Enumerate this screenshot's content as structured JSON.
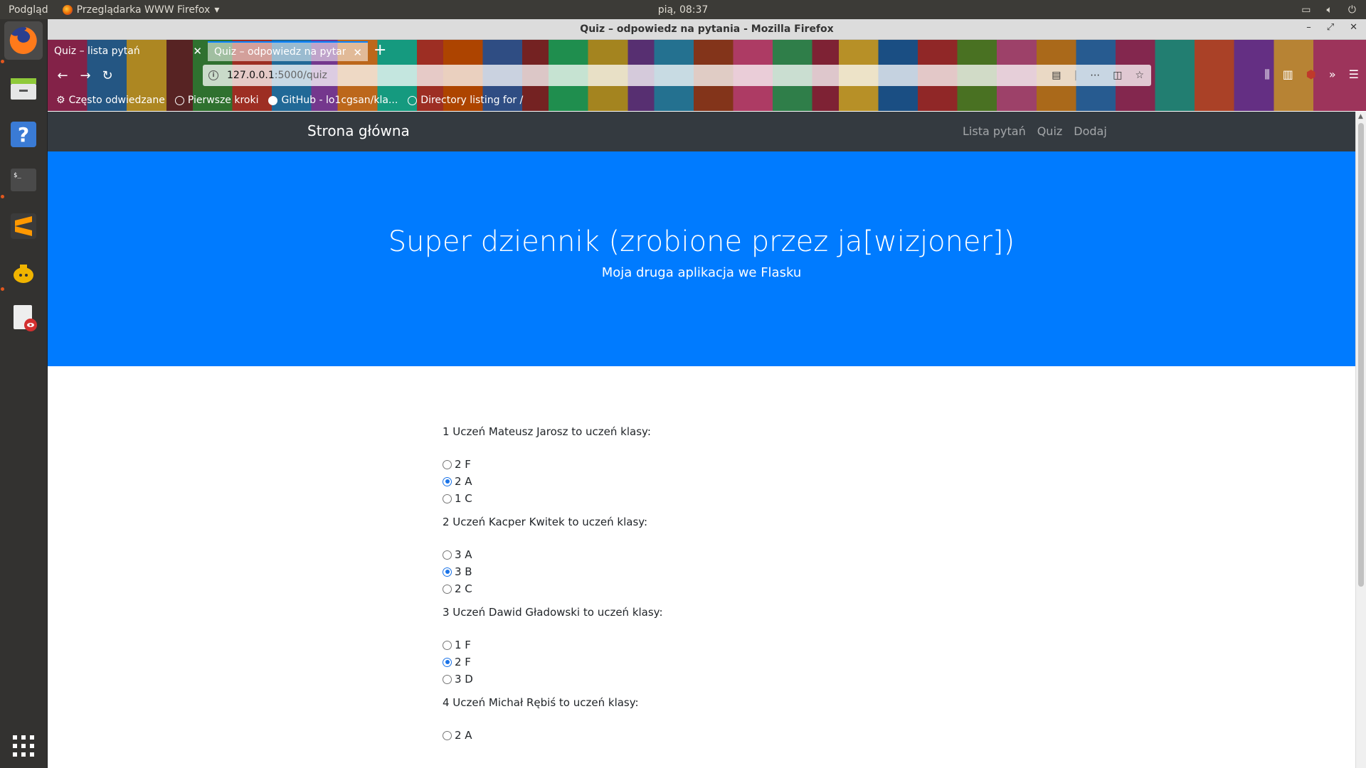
{
  "top_panel": {
    "app_name": "Podgląd",
    "browser_menu": "Przeglądarka WWW Firefox",
    "clock": "pią, 08:37"
  },
  "window": {
    "title": "Quiz – odpowiedz na pytania - Mozilla Firefox"
  },
  "tabs": [
    {
      "label": "Quiz – lista pytań",
      "selected": false
    },
    {
      "label": "Quiz – odpowiedz na pytan",
      "selected": true
    }
  ],
  "url": {
    "host": "127.0.0.1",
    "path": ":5000/quiz"
  },
  "bookmarks": [
    {
      "label": "Często odwiedzane",
      "icon": "gear-icon"
    },
    {
      "label": "Pierwsze kroki",
      "icon": "globe-icon"
    },
    {
      "label": "GitHub - lo1cgsan/kla...",
      "icon": "github-icon"
    },
    {
      "label": "Directory listing for /",
      "icon": "globe-icon"
    }
  ],
  "site": {
    "brand": "Strona główna",
    "links": [
      "Lista pytań",
      "Quiz",
      "Dodaj"
    ],
    "title": "Super dziennik (zrobione przez ja[wizjoner])",
    "subtitle": "Moja druga aplikacja we Flasku"
  },
  "quiz": [
    {
      "question": "1 Uczeń Mateusz Jarosz to uczeń klasy:",
      "options": [
        "2 F",
        "2 A",
        "1 C"
      ],
      "selected": 1
    },
    {
      "question": "2 Uczeń Kacper Kwitek to uczeń klasy:",
      "options": [
        "3 A",
        "3 B",
        "2 C"
      ],
      "selected": 1
    },
    {
      "question": "3 Uczeń Dawid Gładowski to uczeń klasy:",
      "options": [
        "1 F",
        "2 F",
        "3 D"
      ],
      "selected": 1
    },
    {
      "question": "4 Uczeń Michał Rębiś to uczeń klasy:",
      "options": [
        "2 A"
      ],
      "selected": -1
    }
  ],
  "colors": {
    "jumbotron": "#007bff",
    "navbar": "#343a40"
  }
}
